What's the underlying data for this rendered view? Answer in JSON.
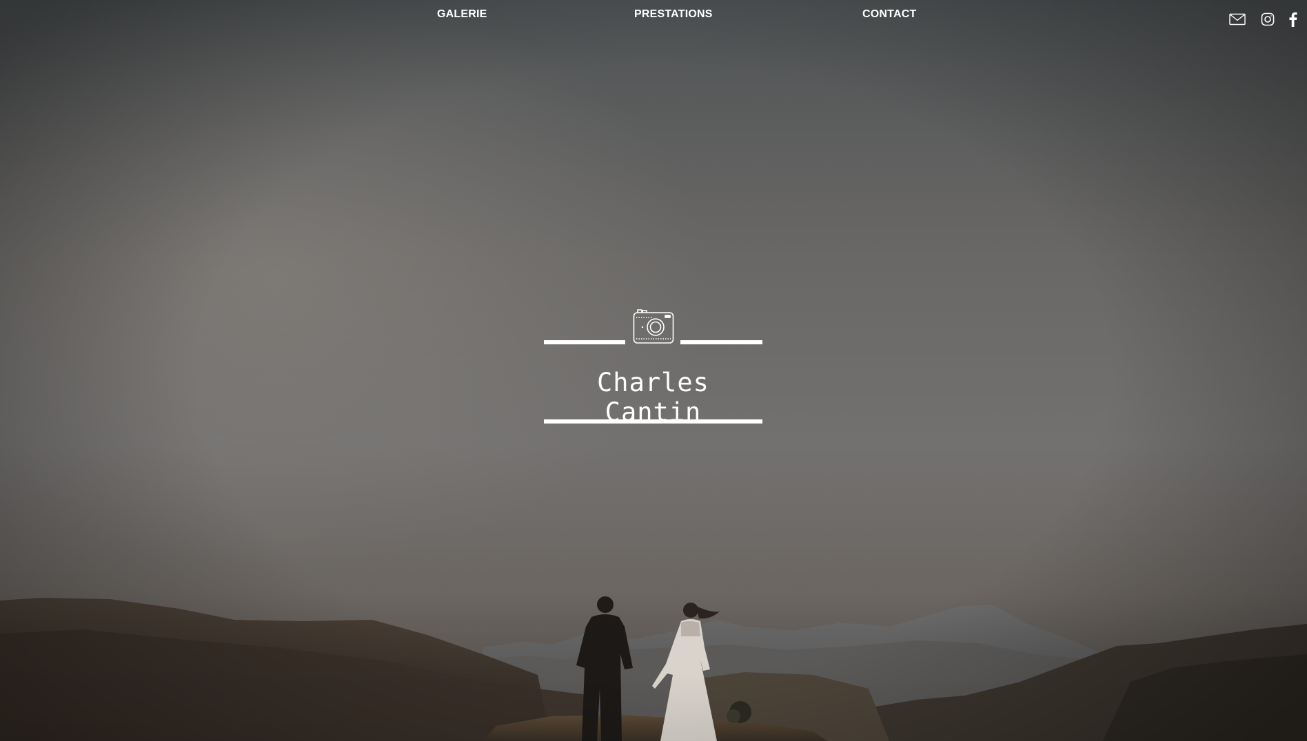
{
  "nav": {
    "items": [
      {
        "label": "GALERIE"
      },
      {
        "label": "PRESTATIONS"
      },
      {
        "label": "CONTACT"
      }
    ]
  },
  "social": {
    "icons": [
      "mail-icon",
      "instagram-icon",
      "facebook-icon"
    ]
  },
  "logo": {
    "name": "Charles Cantin",
    "icon": "camera-icon"
  },
  "colors": {
    "text": "#ffffff",
    "overlay": "#6a6866"
  }
}
